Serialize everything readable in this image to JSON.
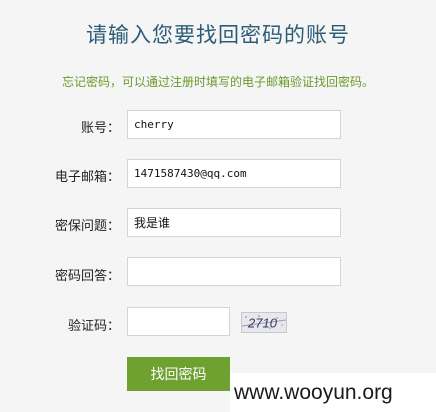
{
  "page": {
    "title": "请输入您要找回密码的账号",
    "hint": "忘记密码，可以通过注册时填写的电子邮箱验证找回密码。"
  },
  "form": {
    "account": {
      "label": "账号：",
      "value": "cherry"
    },
    "email": {
      "label": "电子邮箱：",
      "value": "1471587430@qq.com"
    },
    "question": {
      "label": "密保问题：",
      "value": "我是谁"
    },
    "answer": {
      "label": "密码回答：",
      "value": ""
    },
    "captcha": {
      "label": "验证码：",
      "value": "",
      "image_text": "2710"
    },
    "submit_label": "找回密码"
  },
  "watermark": "www.wooyun.org",
  "colors": {
    "title": "#2c5d78",
    "hint": "#6a9a2c",
    "button": "#6fa131",
    "background": "#f5f5f5"
  }
}
